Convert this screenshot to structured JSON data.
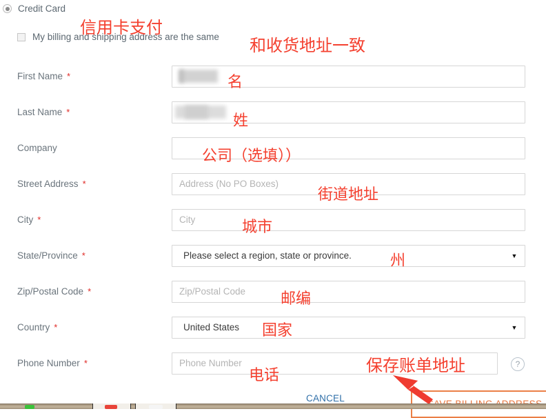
{
  "payment": {
    "method_label": "Credit Card",
    "method_annotation": "信用卡支付",
    "same_address_label": "My billing and shipping address are the same",
    "same_address_annotation": "和收货地址一致"
  },
  "form": {
    "rows": [
      {
        "label": "First Name",
        "required": true,
        "type": "text",
        "value": "",
        "placeholder": "",
        "redacted": true,
        "annotation": "名"
      },
      {
        "label": "Last Name",
        "required": true,
        "type": "text",
        "value": "",
        "placeholder": "",
        "redacted": true,
        "annotation": "姓"
      },
      {
        "label": "Company",
        "required": false,
        "type": "text",
        "value": "",
        "placeholder": "",
        "redacted": false,
        "annotation": "公司（选填））"
      },
      {
        "label": "Street Address",
        "required": true,
        "type": "text",
        "value": "",
        "placeholder": "Address (No PO Boxes)",
        "redacted": false,
        "annotation": "街道地址"
      },
      {
        "label": "City",
        "required": true,
        "type": "text",
        "value": "",
        "placeholder": "City",
        "redacted": false,
        "annotation": "城市"
      },
      {
        "label": "State/Province",
        "required": true,
        "type": "select",
        "value": "Please select a region, state or province.",
        "placeholder": "",
        "redacted": false,
        "annotation": "州"
      },
      {
        "label": "Zip/Postal Code",
        "required": true,
        "type": "text",
        "value": "",
        "placeholder": "Zip/Postal Code",
        "redacted": false,
        "annotation": "邮编"
      },
      {
        "label": "Country",
        "required": true,
        "type": "select",
        "value": "United States",
        "placeholder": "",
        "redacted": false,
        "annotation": "国家"
      },
      {
        "label": "Phone Number",
        "required": true,
        "type": "text",
        "value": "",
        "placeholder": "Phone Number",
        "redacted": false,
        "annotation": "电话"
      }
    ],
    "required_marker": "*",
    "select_arrow_glyph": "▼",
    "help_icon_glyph": "?"
  },
  "actions": {
    "cancel_label": "CANCEL",
    "save_label": "SAVE BILLING ADDRESS",
    "save_annotation": "保存账单地址"
  },
  "colors": {
    "annotation_red": "#f4402f",
    "required_red": "#e02b27",
    "link_blue": "#2f6fa8",
    "button_orange": "#eb7f46",
    "label_gray": "#6a747c",
    "placeholder_gray": "#b4b4b4",
    "border_gray": "#d6d6d6"
  }
}
